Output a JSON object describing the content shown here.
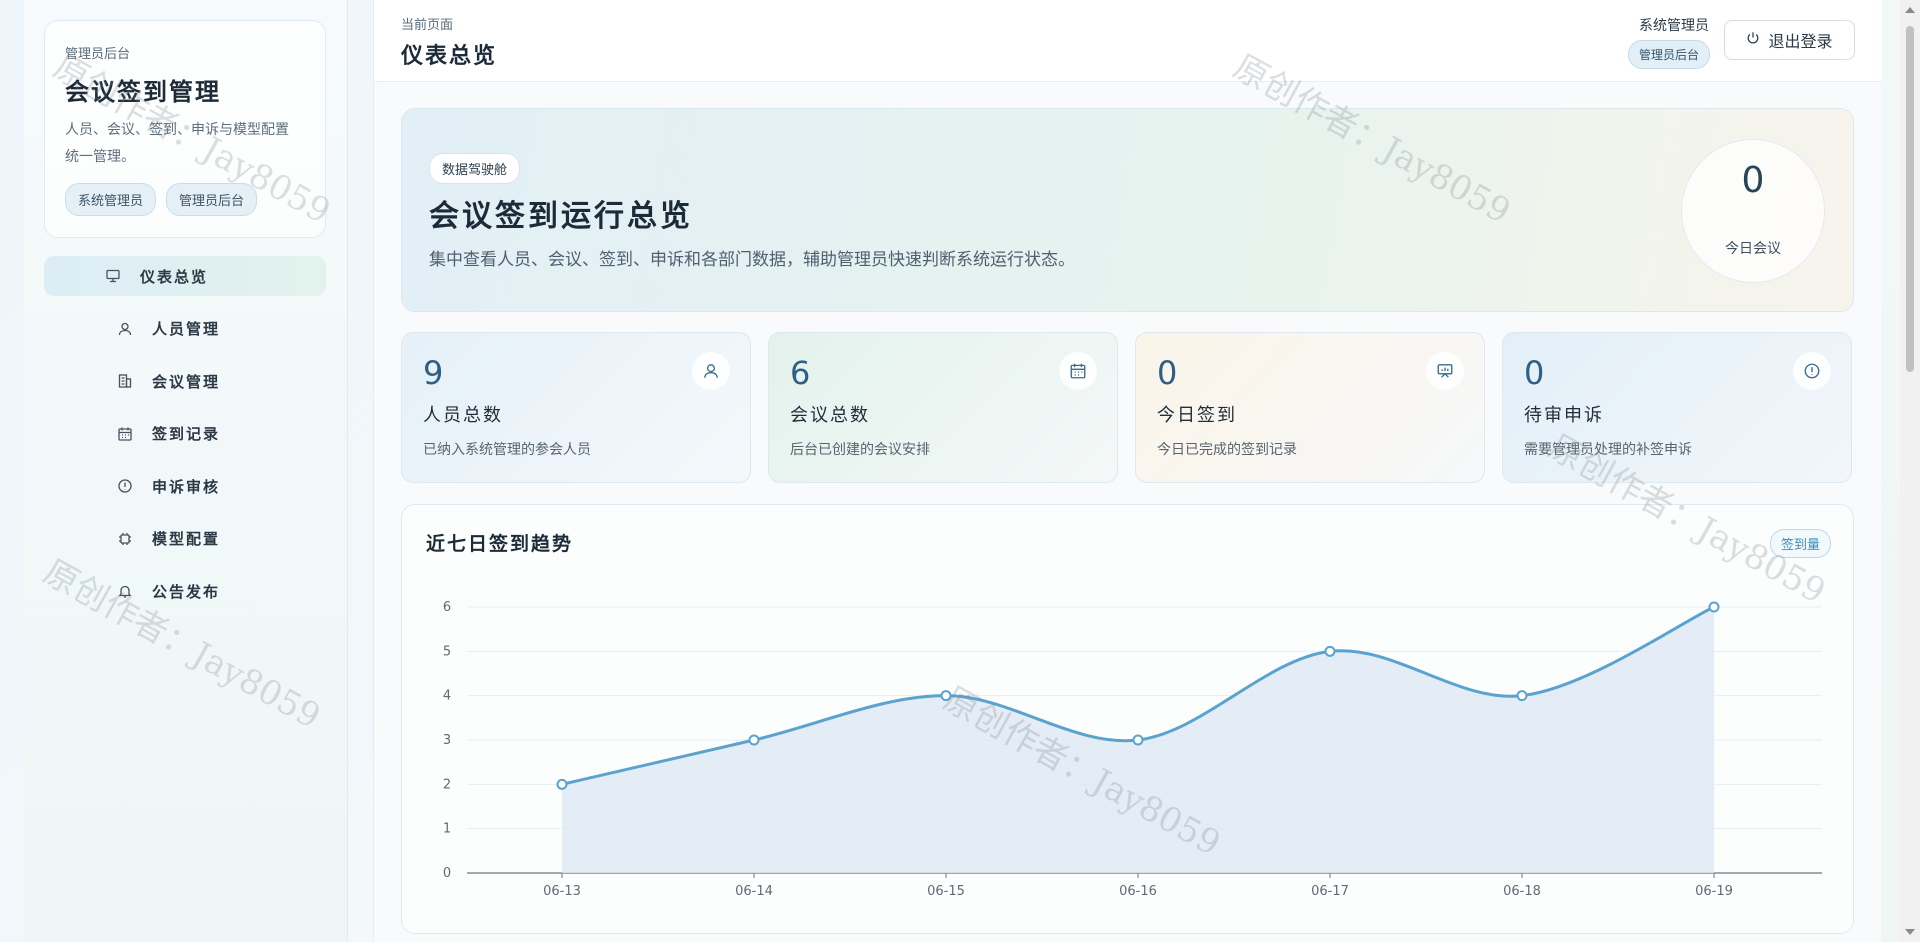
{
  "sidebar": {
    "brand_kicker": "管理员后台",
    "brand_title": "会议签到管理",
    "brand_desc_line1": "人员、会议、签到、申诉与模型配置",
    "brand_desc_line2": "统一管理。",
    "tags": [
      "系统管理员",
      "管理员后台"
    ],
    "items": [
      {
        "label": "仪表总览",
        "icon": "dashboard-icon",
        "active": true
      },
      {
        "label": "人员管理",
        "icon": "user-icon",
        "active": false
      },
      {
        "label": "会议管理",
        "icon": "building-icon",
        "active": false
      },
      {
        "label": "签到记录",
        "icon": "calendar-icon",
        "active": false
      },
      {
        "label": "申诉审核",
        "icon": "alert-circle-icon",
        "active": false
      },
      {
        "label": "模型配置",
        "icon": "chip-icon",
        "active": false
      },
      {
        "label": "公告发布",
        "icon": "bell-icon",
        "active": false
      }
    ]
  },
  "header": {
    "kicker": "当前页面",
    "title": "仪表总览",
    "user_name": "系统管理员",
    "user_role": "管理员后台",
    "logout_label": "退出登录",
    "logout_icon": "power-icon"
  },
  "hero": {
    "badge": "数据驾驶舱",
    "title": "会议签到运行总览",
    "desc": "集中查看人员、会议、签到、申诉和各部门数据，辅助管理员快速判断系统运行状态。",
    "today_meetings_value": "0",
    "today_meetings_label": "今日会议"
  },
  "stats": [
    {
      "value": "9",
      "label": "人员总数",
      "sub": "已纳入系统管理的参会人员",
      "icon": "user-icon"
    },
    {
      "value": "6",
      "label": "会议总数",
      "sub": "后台已创建的会议安排",
      "icon": "calendar-icon"
    },
    {
      "value": "0",
      "label": "今日签到",
      "sub": "今日已完成的签到记录",
      "icon": "presentation-icon"
    },
    {
      "value": "0",
      "label": "待审申诉",
      "sub": "需要管理员处理的补签申诉",
      "icon": "alert-circle-icon"
    }
  ],
  "chart": {
    "title": "近七日签到趋势",
    "tag": "签到量"
  },
  "chart_data": {
    "type": "line",
    "categories": [
      "06-13",
      "06-14",
      "06-15",
      "06-16",
      "06-17",
      "06-18",
      "06-19"
    ],
    "values": [
      2,
      3,
      4,
      3,
      5,
      4,
      6
    ],
    "ylim": [
      0,
      6
    ],
    "yticks": [
      0,
      1,
      2,
      3,
      4,
      5,
      6
    ],
    "smooth": true,
    "area_fill": true,
    "grid": true,
    "colors": {
      "line": "#5aa3cf",
      "area": "#dde9f3"
    }
  },
  "watermark": {
    "text": "原创作者：Jay8059"
  },
  "colors": {
    "accent": "#2f5f86",
    "active_nav": "#dcedf6"
  }
}
